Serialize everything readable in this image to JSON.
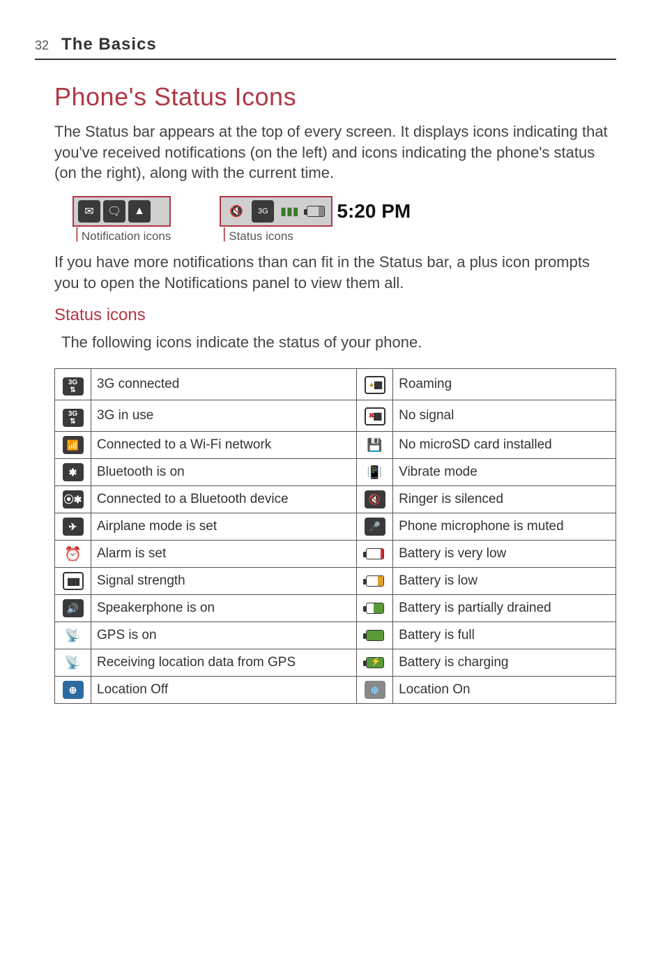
{
  "header": {
    "page_number": "32",
    "section": "The Basics"
  },
  "title": "Phone's Status Icons",
  "intro": "The Status bar appears at the top of every screen. It displays icons indicating that you've received notifications (on the left) and icons indicating the phone's status (on the right), along with the current time.",
  "notification_caption": "Notification icons",
  "status_caption": "Status icons",
  "status_time": "5:20 PM",
  "after_images": "If you have more notifications than can fit in the Status bar, a plus icon prompts you to open the Notifications panel to view them all.",
  "subheading": "Status icons",
  "sub_intro": "The following icons indicate the status of your phone.",
  "table": [
    {
      "l_icon": "3g-connected-icon",
      "l_label": "3G connected",
      "r_icon": "roaming-icon",
      "r_label": "Roaming"
    },
    {
      "l_icon": "3g-in-use-icon",
      "l_label": "3G in use",
      "r_icon": "no-signal-icon",
      "r_label": "No signal"
    },
    {
      "l_icon": "wifi-icon",
      "l_label": "Connected to a Wi-Fi network",
      "r_icon": "no-sd-icon",
      "r_label": "No microSD card installed"
    },
    {
      "l_icon": "bluetooth-icon",
      "l_label": "Bluetooth is on",
      "r_icon": "vibrate-icon",
      "r_label": "Vibrate mode"
    },
    {
      "l_icon": "bluetooth-connected-icon",
      "l_label": "Connected to a Bluetooth device",
      "r_icon": "ringer-silenced-icon",
      "r_label": "Ringer is silenced"
    },
    {
      "l_icon": "airplane-icon",
      "l_label": "Airplane mode is set",
      "r_icon": "mic-muted-icon",
      "r_label": "Phone microphone is muted"
    },
    {
      "l_icon": "alarm-icon",
      "l_label": "Alarm is set",
      "r_icon": "battery-very-low-icon",
      "r_label": "Battery is very low"
    },
    {
      "l_icon": "signal-icon",
      "l_label": "Signal strength",
      "r_icon": "battery-low-icon",
      "r_label": "Battery is low"
    },
    {
      "l_icon": "speakerphone-icon",
      "l_label": "Speakerphone is on",
      "r_icon": "battery-partial-icon",
      "r_label": "Battery is partially drained"
    },
    {
      "l_icon": "gps-icon",
      "l_label": "GPS is on",
      "r_icon": "battery-full-icon",
      "r_label": "Battery is full"
    },
    {
      "l_icon": "gps-receiving-icon",
      "l_label": "Receiving location data from GPS",
      "r_icon": "battery-charging-icon",
      "r_label": "Battery is charging"
    },
    {
      "l_icon": "location-off-icon",
      "l_label": "Location Off",
      "r_icon": "location-on-icon",
      "r_label": "Location On"
    }
  ]
}
